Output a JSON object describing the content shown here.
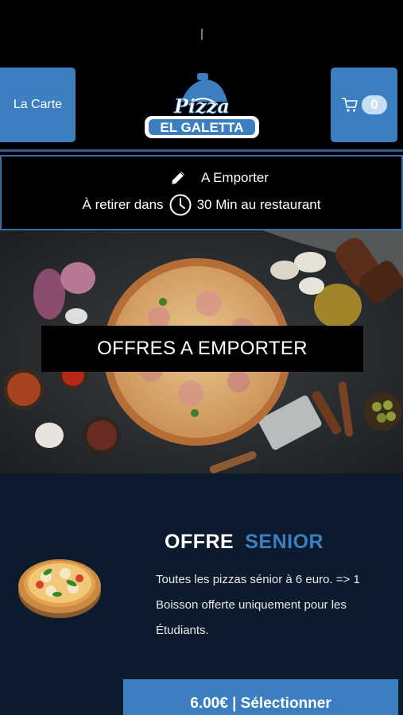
{
  "header": {
    "menu_label": "La Carte",
    "cart_count": "0",
    "logo_top": "Pizza",
    "logo_bottom": "EL GALETTA"
  },
  "order_info": {
    "mode": "A Emporter",
    "pickup_prefix": "À retirer dans",
    "pickup_suffix": "30 Min au restaurant"
  },
  "hero": {
    "banner": "OFFRES A EMPORTER"
  },
  "offer": {
    "title_word1": "OFFRE",
    "title_word2": "SENIOR",
    "description": "Toutes les pizzas sénior à 6 euro.  => 1 Boisson offerte uniquement pour les Étudiants.",
    "button_label": "6.00€ | Sélectionner"
  },
  "colors": {
    "accent": "#3b7fc1",
    "background": "#000000",
    "offer_background": "#0b1b2d"
  }
}
